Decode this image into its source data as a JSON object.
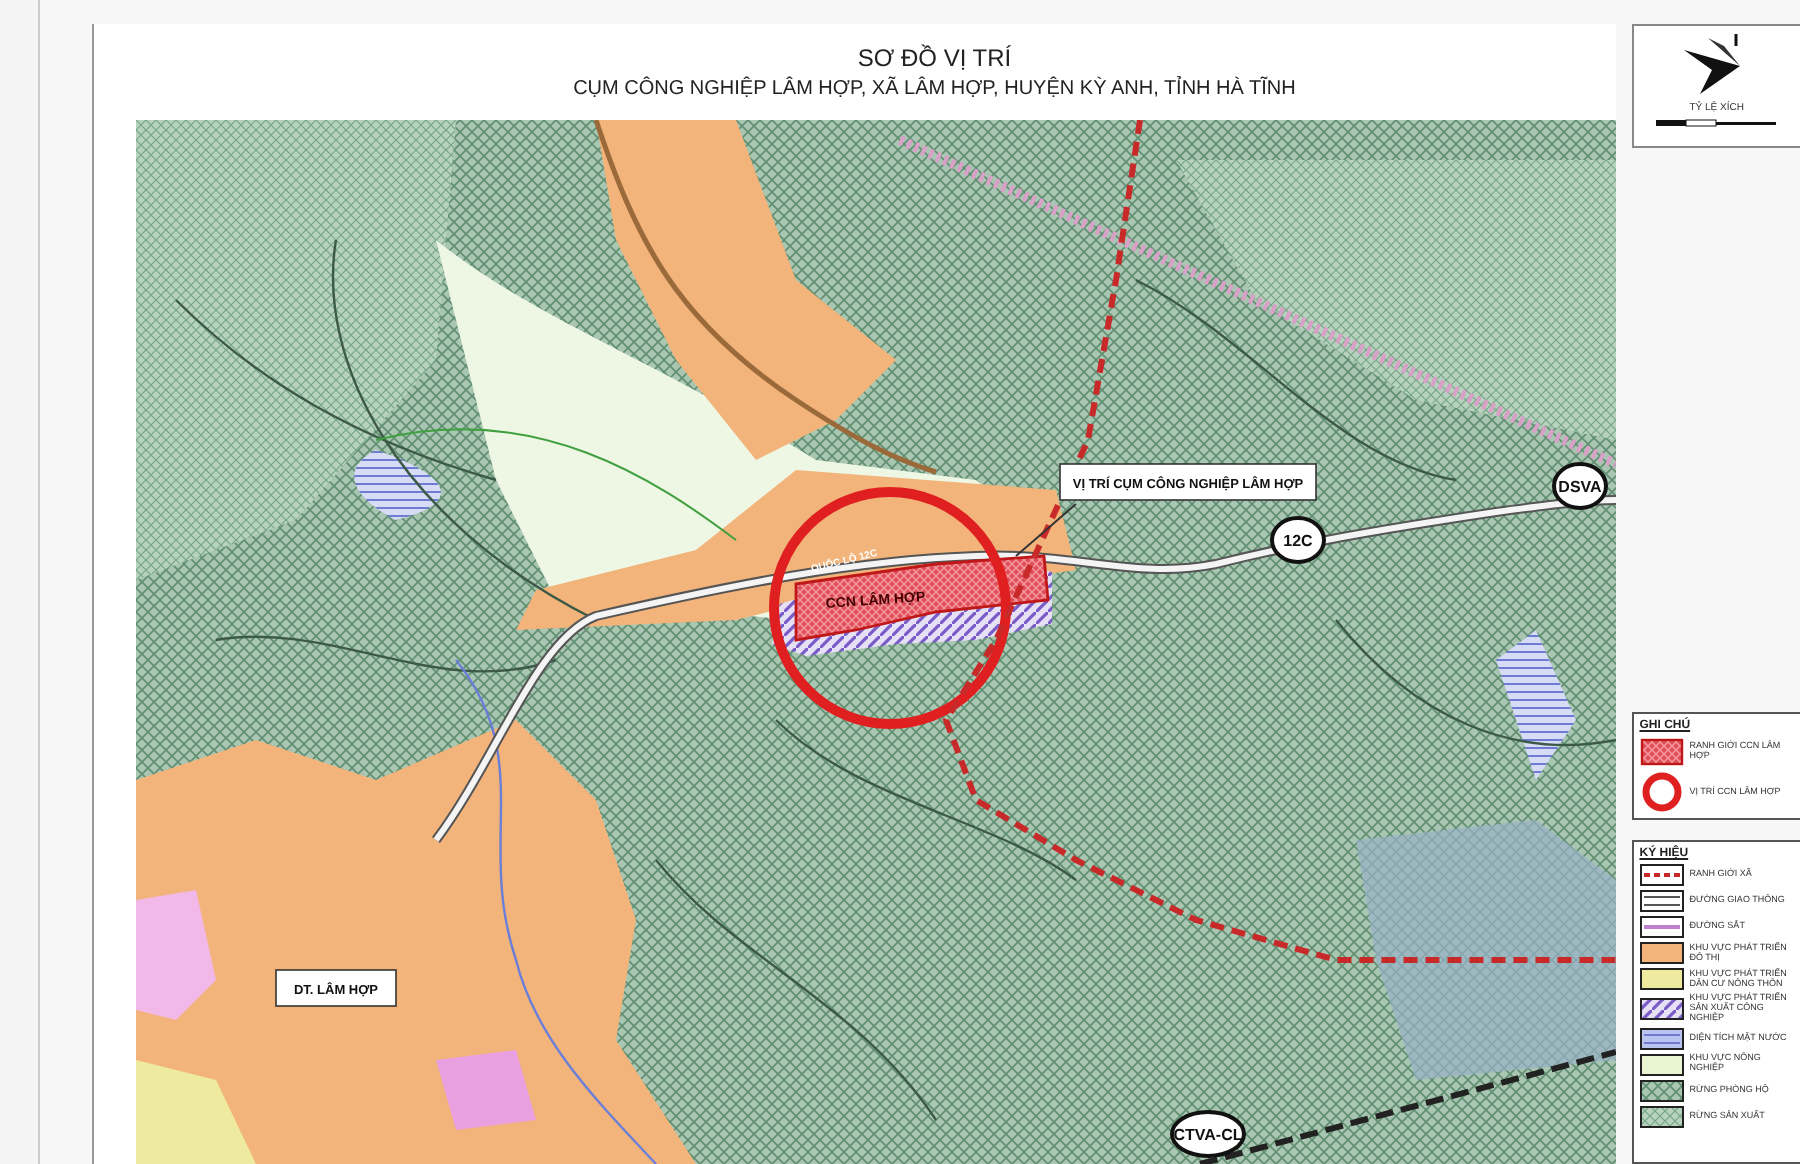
{
  "title": "SƠ ĐỒ VỊ TRÍ",
  "subtitle": "CỤM CÔNG NGHIỆP LÂM HỢP, XÃ LÂM HỢP, HUYỆN KỲ ANH, TỈNH HÀ TĨNH",
  "scale_box": {
    "label": "TỶ LỆ XÍCH"
  },
  "map_labels": [
    {
      "kind": "road",
      "text": "QUỐC LỘ 12C"
    },
    {
      "kind": "zone",
      "text": "CCN LÂM HỢP"
    },
    {
      "kind": "callout",
      "text": "VỊ TRÍ CỤM CÔNG NGHIỆP LÂM HỢP"
    },
    {
      "kind": "marker",
      "text": "12C"
    },
    {
      "kind": "marker",
      "text": "DSVA"
    },
    {
      "kind": "callout",
      "text": "DT. LÂM HỢP"
    },
    {
      "kind": "marker",
      "text": "CTVA-CL"
    }
  ],
  "notes": {
    "title": "GHI CHÚ",
    "items": [
      {
        "kind": "hatch-red",
        "text": "RANH GIỚI CCN LÂM HỢP"
      },
      {
        "kind": "ring",
        "text": "VỊ TRÍ CCN LÂM HỢP"
      }
    ]
  },
  "legend": {
    "title": "KÝ HIỆU",
    "items": [
      {
        "kind": "dash-red",
        "text": "RANH GIỚI XÃ"
      },
      {
        "kind": "road",
        "text": "ĐƯỜNG GIAO THÔNG"
      },
      {
        "kind": "rail",
        "text": "ĐƯỜNG SẮT"
      },
      {
        "kind": "orange",
        "text": "KHU VỰC PHÁT TRIỂN ĐÔ THỊ"
      },
      {
        "kind": "yellow",
        "text": "KHU VỰC PHÁT TRIỂN DÂN CƯ NÔNG THÔN"
      },
      {
        "kind": "purple",
        "text": "KHU VỰC PHÁT TRIỂN SẢN XUẤT CÔNG NGHIỆP"
      },
      {
        "kind": "water",
        "text": "DIỆN TÍCH MẶT NƯỚC"
      },
      {
        "kind": "farm",
        "text": "KHU VỰC NÔNG NGHIỆP"
      },
      {
        "kind": "forest",
        "text": "RỪNG PHÒNG HỘ"
      },
      {
        "kind": "forest2",
        "text": "RỪNG SẢN XUẤT"
      }
    ]
  }
}
